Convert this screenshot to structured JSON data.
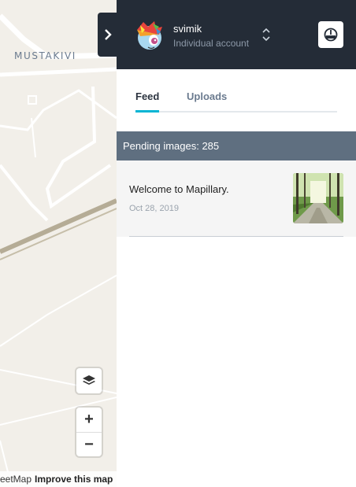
{
  "map": {
    "place_label": "MUSTAKIVI",
    "attribution_text": "eetMap",
    "improve_link": "Improve this map",
    "zoom_in_label": "+",
    "zoom_out_label": "−",
    "layers_icon": "layers-icon"
  },
  "sidebar_toggle": {
    "icon": "chevron-right-icon"
  },
  "user": {
    "name": "svimik",
    "account_type": "Individual account",
    "avatar_icon": "pony-avatar",
    "switch_icon": "chevron-up-down-icon",
    "logout_icon": "logout-icon"
  },
  "tabs": [
    {
      "label": "Feed",
      "active": true
    },
    {
      "label": "Uploads",
      "active": false
    }
  ],
  "pending": {
    "label": "Pending images: 285"
  },
  "feed": [
    {
      "title": "Welcome to Mapillary.",
      "date": "Oct 28, 2019",
      "thumbnail": "forest-path-image"
    }
  ],
  "colors": {
    "header_bg": "#242c37",
    "accent": "#05b5d4",
    "pending_bg": "#5f6f80",
    "map_bg": "#f2efe9"
  }
}
